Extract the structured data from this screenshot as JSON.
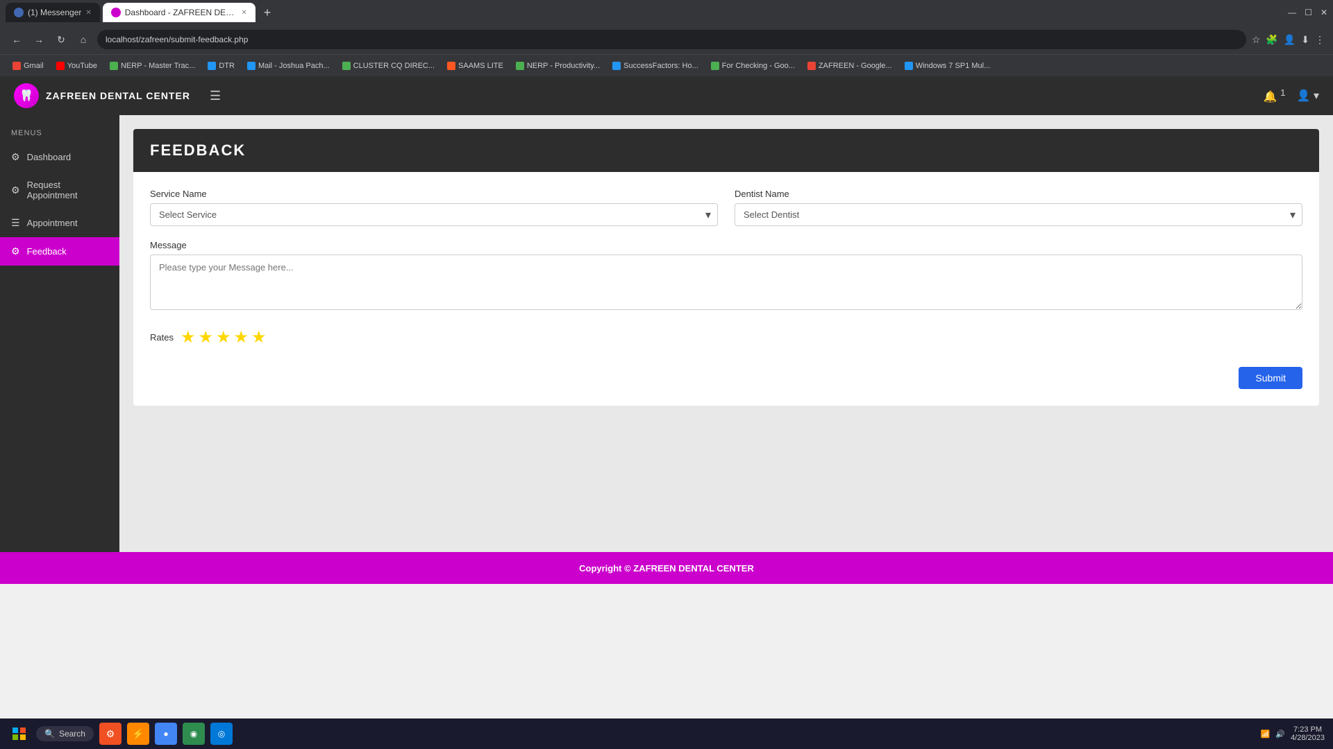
{
  "browser": {
    "tabs": [
      {
        "id": "tab1",
        "title": "(1) Messenger",
        "active": false,
        "favicon_color": "#4267B2"
      },
      {
        "id": "tab2",
        "title": "Dashboard - ZAFREEN DENTAL C...",
        "active": true,
        "favicon_color": "#cc00cc"
      }
    ],
    "url": "localhost/zafreen/submit-feedback.php",
    "bookmarks": [
      {
        "label": "Gmail",
        "color": "#EA4335"
      },
      {
        "label": "YouTube",
        "color": "#FF0000"
      },
      {
        "label": "NERP - Master Trac...",
        "color": "#4CAF50"
      },
      {
        "label": "DTR",
        "color": "#2196F3"
      },
      {
        "label": "Mail - Joshua Pach...",
        "color": "#2196F3"
      },
      {
        "label": "CLUSTER CQ DIREC...",
        "color": "#4CAF50"
      },
      {
        "label": "SAAMS LITE",
        "color": "#FF5722"
      },
      {
        "label": "NERP - Productivity...",
        "color": "#4CAF50"
      },
      {
        "label": "SuccessFactors: Ho...",
        "color": "#2196F3"
      },
      {
        "label": "For Checking - Goo...",
        "color": "#4CAF50"
      },
      {
        "label": "ZAFREEN - Google...",
        "color": "#EA4335"
      },
      {
        "label": "Windows 7 SP1 Mul...",
        "color": "#2196F3"
      }
    ]
  },
  "app": {
    "name": "ZAFREEN DENTAL CENTER",
    "notification_count": "1"
  },
  "sidebar": {
    "section_label": "MENUS",
    "items": [
      {
        "id": "dashboard",
        "label": "Dashboard",
        "icon": "⚙",
        "active": false
      },
      {
        "id": "request-appointment",
        "label": "Request Appointment",
        "icon": "⚙",
        "active": false
      },
      {
        "id": "appointment",
        "label": "Appointment",
        "icon": "☰",
        "active": false
      },
      {
        "id": "feedback",
        "label": "Feedback",
        "icon": "⚙",
        "active": true
      }
    ]
  },
  "page": {
    "title": "FEEDBACK",
    "form": {
      "service_name_label": "Service Name",
      "service_name_placeholder": "Select Service",
      "dentist_name_label": "Dentist Name",
      "dentist_name_placeholder": "Select Dentist",
      "message_label": "Message",
      "message_placeholder": "Please type your Message here...",
      "rates_label": "Rates",
      "star_count": 5,
      "submit_label": "Submit"
    }
  },
  "footer": {
    "text": "Copyright © ZAFREEN DENTAL CENTER"
  },
  "taskbar": {
    "search_label": "Search",
    "time": "7:23 PM",
    "date": "4/28/2023"
  }
}
